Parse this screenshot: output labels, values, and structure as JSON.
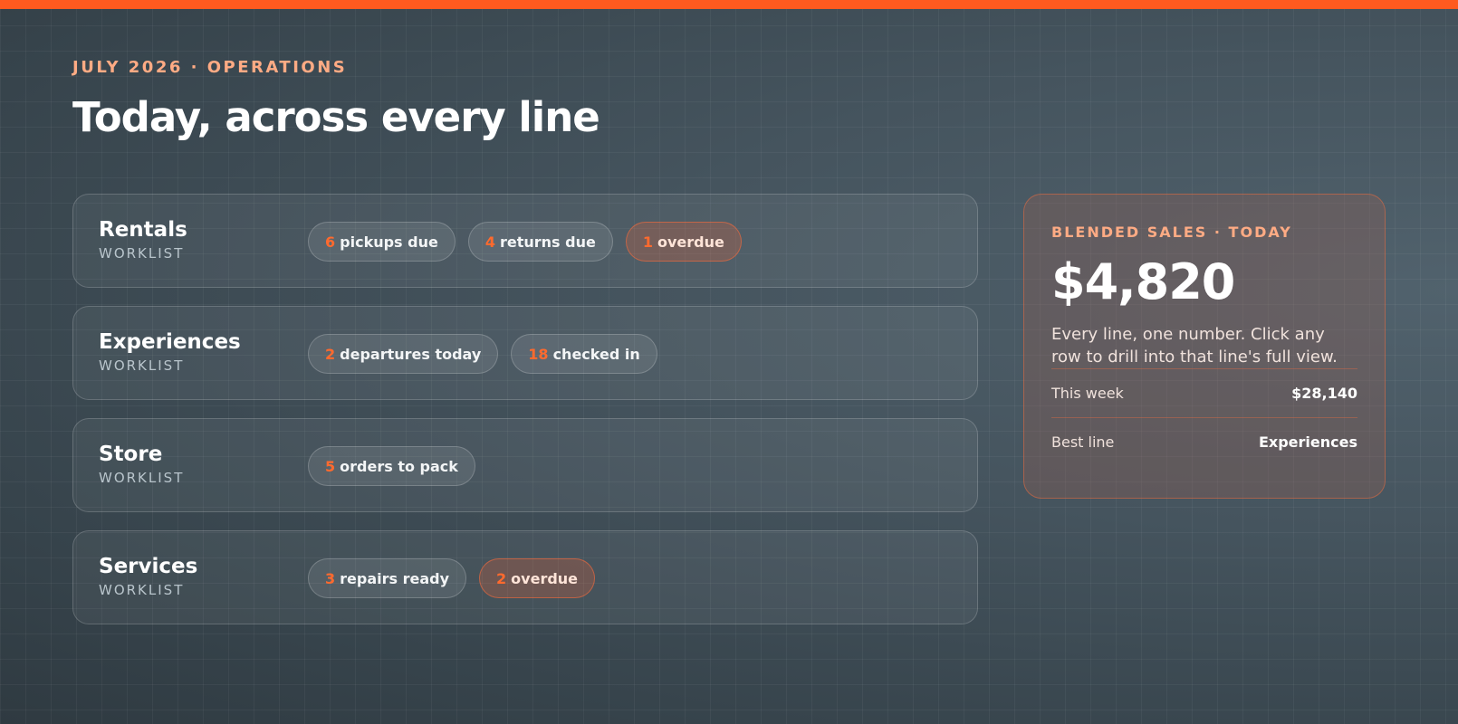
{
  "header": {
    "eyebrow": "JULY 2026 · OPERATIONS",
    "title": "Today, across every line"
  },
  "lines": [
    {
      "name": "Rentals",
      "sub": "WORKLIST",
      "pills": [
        {
          "num": "6",
          "text": "pickups due",
          "alert": false
        },
        {
          "num": "4",
          "text": "returns due",
          "alert": false
        },
        {
          "num": "1",
          "text": "overdue",
          "alert": true
        }
      ]
    },
    {
      "name": "Experiences",
      "sub": "WORKLIST",
      "pills": [
        {
          "num": "2",
          "text": "departures today",
          "alert": false
        },
        {
          "num": "18",
          "text": "checked in",
          "alert": false
        }
      ]
    },
    {
      "name": "Store",
      "sub": "WORKLIST",
      "pills": [
        {
          "num": "5",
          "text": "orders to pack",
          "alert": false
        }
      ]
    },
    {
      "name": "Services",
      "sub": "WORKLIST",
      "pills": [
        {
          "num": "3",
          "text": "repairs ready",
          "alert": false
        },
        {
          "num": "2",
          "text": "overdue",
          "alert": true
        }
      ]
    }
  ],
  "sales": {
    "eyebrow": "BLENDED SALES · TODAY",
    "value": "$4,820",
    "description": "Every line, one number. Click any row to drill into that line's full view.",
    "stats": [
      {
        "label": "This week",
        "value": "$28,140"
      },
      {
        "label": "Best line",
        "value": "Experiences"
      }
    ]
  },
  "colors": {
    "accent": "#ff5a1f",
    "eyebrow": "#ffab84",
    "number": "#ff6a2e"
  }
}
